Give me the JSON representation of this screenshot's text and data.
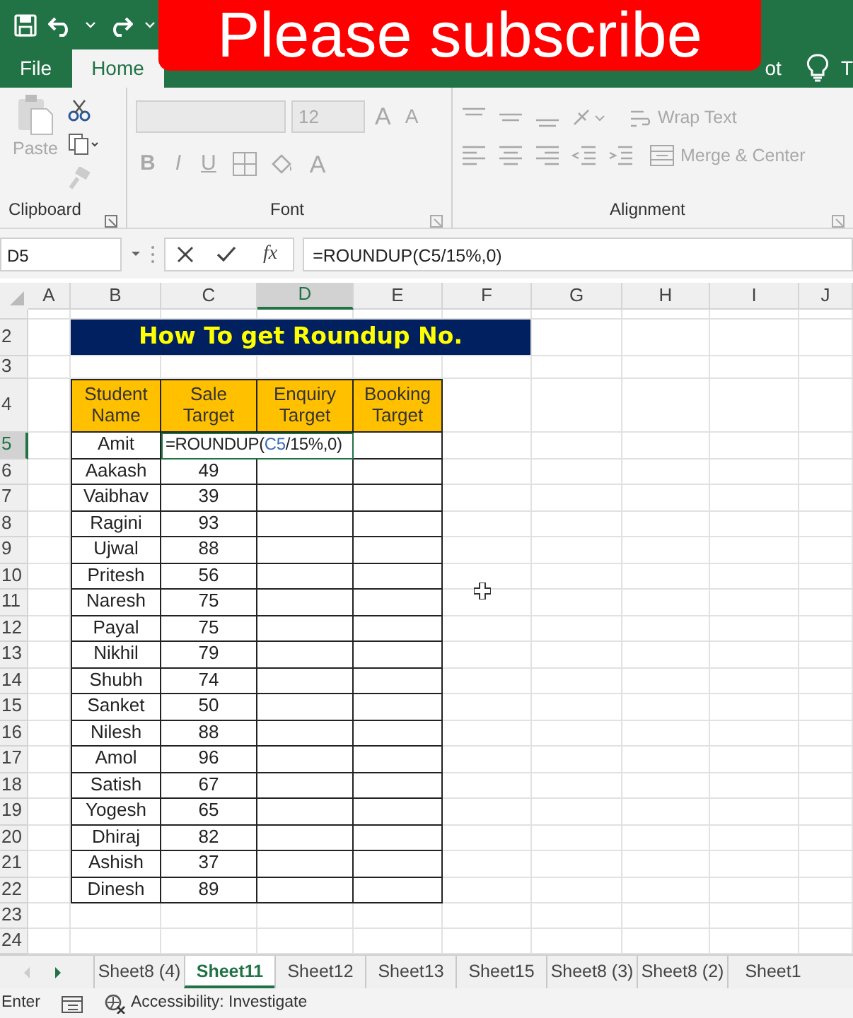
{
  "overlay_banner": {
    "text": "Please subscribe"
  },
  "ribbon_tabs": [
    {
      "label": "File",
      "kind": "tab",
      "selected": false
    },
    {
      "label": "Home",
      "kind": "tab",
      "selected": true
    },
    {
      "label": "ot",
      "kind": "tab",
      "selected": false
    },
    {
      "label": "T",
      "kind": "tell-me",
      "selected": false
    }
  ],
  "ribbon": {
    "disabled": true,
    "clipboard": {
      "paste": "Paste",
      "label": "Clipboard"
    },
    "font": {
      "size": "12",
      "grow": "A",
      "shrink": "A",
      "bold": "B",
      "italic": "I",
      "underline": "U",
      "font_color": "A",
      "label": "Font"
    },
    "alignment": {
      "wrap": "Wrap Text",
      "merge": "Merge & Center",
      "label": "Alignment"
    }
  },
  "formula_bar": {
    "name_box": "D5",
    "fx": "fx",
    "formula": "=ROUNDUP(C5/15%,0)"
  },
  "sheet": {
    "columns": [
      {
        "label": "A",
        "selected": false
      },
      {
        "label": "B",
        "selected": false
      },
      {
        "label": "C",
        "selected": false
      },
      {
        "label": "D",
        "selected": true
      },
      {
        "label": "E",
        "selected": false
      },
      {
        "label": "F",
        "selected": false
      },
      {
        "label": "G",
        "selected": false
      },
      {
        "label": "H",
        "selected": false
      },
      {
        "label": "I",
        "selected": false
      },
      {
        "label": "J",
        "selected": false
      }
    ],
    "rows": [
      {
        "label": "",
        "selected": false
      },
      {
        "label": "2",
        "selected": false
      },
      {
        "label": "3",
        "selected": false
      },
      {
        "label": "4",
        "selected": false
      },
      {
        "label": "5",
        "selected": true
      },
      {
        "label": "6",
        "selected": false
      },
      {
        "label": "7",
        "selected": false
      },
      {
        "label": "8",
        "selected": false
      },
      {
        "label": "9",
        "selected": false
      },
      {
        "label": "10",
        "selected": false
      },
      {
        "label": "11",
        "selected": false
      },
      {
        "label": "12",
        "selected": false
      },
      {
        "label": "13",
        "selected": false
      },
      {
        "label": "14",
        "selected": false
      },
      {
        "label": "15",
        "selected": false
      },
      {
        "label": "16",
        "selected": false
      },
      {
        "label": "17",
        "selected": false
      },
      {
        "label": "18",
        "selected": false
      },
      {
        "label": "19",
        "selected": false
      },
      {
        "label": "20",
        "selected": false
      },
      {
        "label": "21",
        "selected": false
      },
      {
        "label": "22",
        "selected": false
      },
      {
        "label": "23",
        "selected": false
      },
      {
        "label": "24",
        "selected": false
      }
    ],
    "title": "How To get Roundup No.",
    "table": {
      "columns": [
        "Student Name",
        "Sale Target",
        "Enquiry Target",
        "Booking Target"
      ],
      "rows": [
        {
          "name": "Amit",
          "editing": [
            {
              "text": "=ROUNDUP(",
              "kind": "plain"
            },
            {
              "text": "C5",
              "kind": "ref"
            },
            {
              "text": "/15%,0)",
              "kind": "plain"
            }
          ]
        },
        {
          "name": "Aakash",
          "sale": "49"
        },
        {
          "name": "Vaibhav",
          "sale": "39"
        },
        {
          "name": "Ragini",
          "sale": "93"
        },
        {
          "name": "Ujwal",
          "sale": "88"
        },
        {
          "name": "Pritesh",
          "sale": "56"
        },
        {
          "name": "Naresh",
          "sale": "75"
        },
        {
          "name": "Payal",
          "sale": "75"
        },
        {
          "name": "Nikhil",
          "sale": "79"
        },
        {
          "name": "Shubh",
          "sale": "74"
        },
        {
          "name": "Sanket",
          "sale": "50"
        },
        {
          "name": "Nilesh",
          "sale": "88"
        },
        {
          "name": "Amol",
          "sale": "96"
        },
        {
          "name": "Satish",
          "sale": "67"
        },
        {
          "name": "Yogesh",
          "sale": "65"
        },
        {
          "name": "Dhiraj",
          "sale": "82"
        },
        {
          "name": "Ashish",
          "sale": "37"
        },
        {
          "name": "Dinesh",
          "sale": "89"
        }
      ]
    }
  },
  "sheet_tabs": [
    {
      "label": "Sheet8 (4)",
      "selected": false
    },
    {
      "label": "Sheet11",
      "selected": true
    },
    {
      "label": "Sheet12",
      "selected": false
    },
    {
      "label": "Sheet13",
      "selected": false
    },
    {
      "label": "Sheet15",
      "selected": false
    },
    {
      "label": "Sheet8 (3)",
      "selected": false
    },
    {
      "label": "Sheet8 (2)",
      "selected": false
    },
    {
      "label": "Sheet1",
      "selected": false
    }
  ],
  "status_bar": {
    "mode": "Enter",
    "accessibility": "Accessibility: Investigate"
  }
}
